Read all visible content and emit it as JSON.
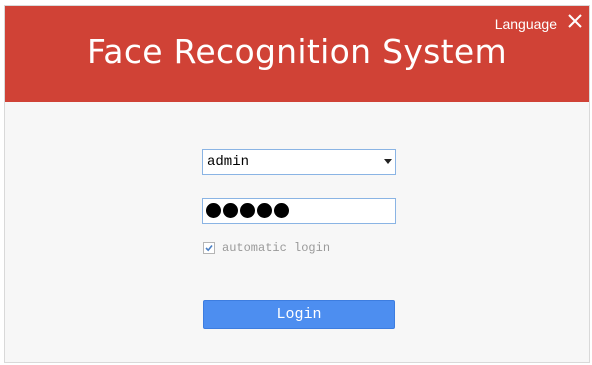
{
  "header": {
    "title": "Face Recognition System",
    "language_label": "Language",
    "close_icon": "close-icon"
  },
  "form": {
    "username_value": "admin",
    "password_mask_count": 5,
    "auto_login_label": "automatic login",
    "auto_login_checked": true,
    "login_label": "Login"
  },
  "colors": {
    "header_bg": "#d04236",
    "button_bg": "#4d8ef0",
    "field_border": "#8ab4e4"
  }
}
